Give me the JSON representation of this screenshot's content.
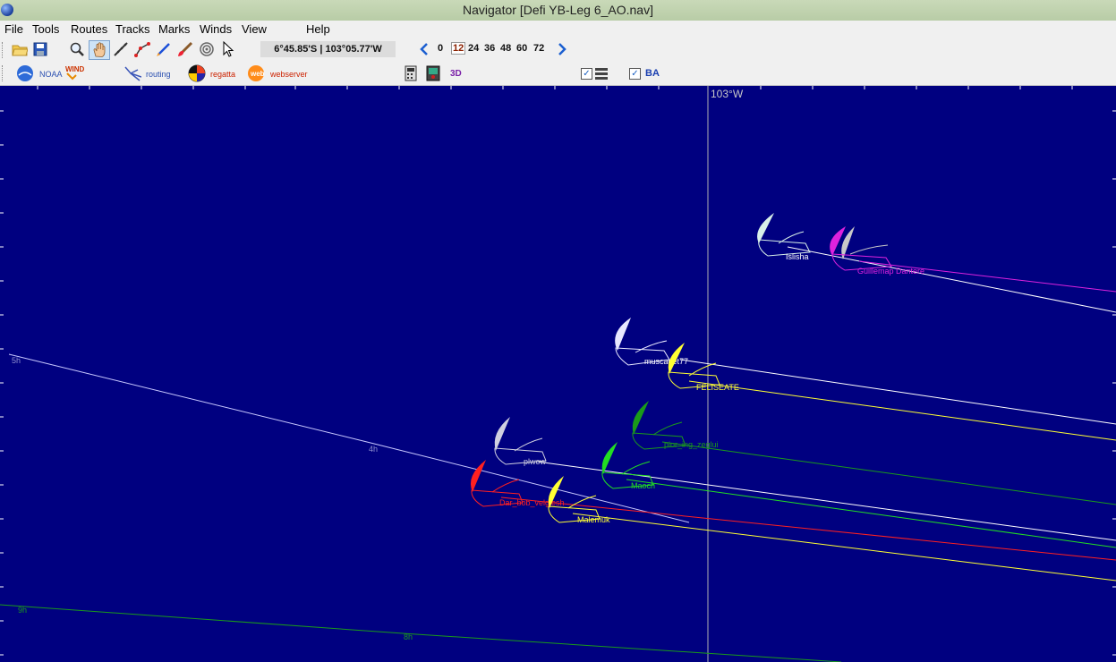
{
  "window": {
    "title": "Navigator [Defi YB-Leg 6_AO.nav]"
  },
  "menu": [
    "File",
    "Tools",
    "Routes",
    "Tracks",
    "Marks",
    "Winds",
    "View",
    "Help"
  ],
  "toolbar": {
    "position": "6°45.85'S | 103°05.77'W",
    "hours": [
      "0",
      "12",
      "24",
      "36",
      "48",
      "60",
      "72"
    ],
    "selected_hour": "12"
  },
  "toolbar2": {
    "noaa": "NOAA",
    "wind": "WIND",
    "routing": "routing",
    "regatta": "regatta",
    "webserver": "webserver",
    "webicon": "web",
    "threed": "3D",
    "ba": "BA"
  },
  "chart": {
    "meridian_label": "103°W",
    "track_hour_labels": [
      "5h",
      "4h",
      "9h",
      "8h"
    ],
    "colors": {
      "sea": "#000080",
      "white": "#ffffff",
      "yellow": "#ffff33",
      "red": "#ff2020",
      "green": "#22dd22",
      "darkgreen": "#1a9a1a",
      "magenta": "#dd22dd",
      "lavender": "#c8c8ff"
    },
    "boats": [
      {
        "name": "Islisha",
        "color": "#d8f0e8"
      },
      {
        "name": "Guillemap Dantere",
        "color": "#dd22dd"
      },
      {
        "name": "muscadet77",
        "color": "#e8e8ff"
      },
      {
        "name": "FELISEATE",
        "color": "#ffff33"
      },
      {
        "name": "pior_ing_zeglui",
        "color": "#1a9a1a"
      },
      {
        "name": "plwow",
        "color": "#d0d0e0"
      },
      {
        "name": "Maoch",
        "color": "#22dd22"
      },
      {
        "name": "Dar_bob_velgjesh",
        "color": "#ff2020"
      },
      {
        "name": "Malemuk",
        "color": "#ffff33"
      }
    ]
  }
}
